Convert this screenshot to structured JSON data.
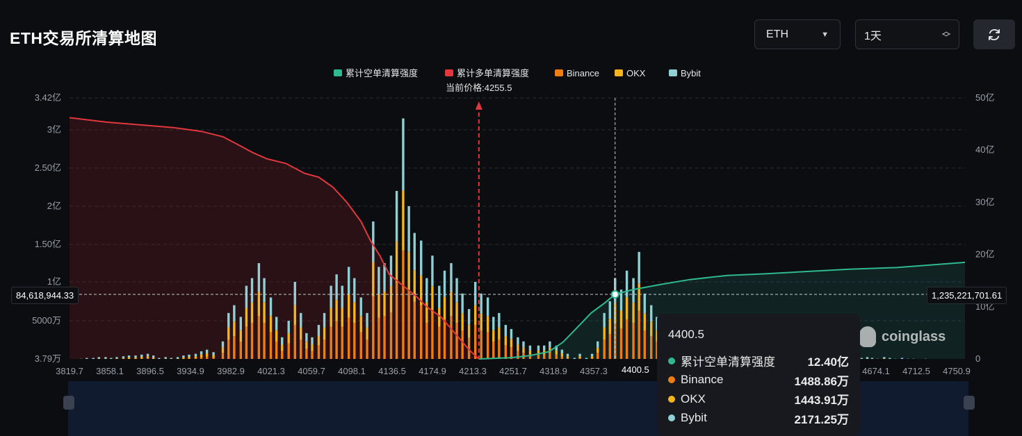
{
  "header": {
    "title": "ETH交易所清算地图",
    "coin_select": "ETH",
    "range_select": "1天",
    "refresh_icon": "refresh-icon"
  },
  "colors": {
    "short_line": "#2fb98f",
    "long_line": "#e2383d",
    "binance": "#f07d12",
    "okx": "#f4b51d",
    "bybit": "#8fd0d4",
    "marker": "#e2383d"
  },
  "chart_data": {
    "type": "bar",
    "x_ticks": [
      "3819.7",
      "3858.1",
      "3896.5",
      "3934.9",
      "3982.9",
      "4021.3",
      "4059.7",
      "4098.1",
      "4136.5",
      "4174.9",
      "4213.3",
      "4251.7",
      "4318.9",
      "4357.3",
      "4400.5",
      "",
      "",
      "",
      "",
      "",
      "4674.1",
      "4712.5",
      "4750.9"
    ],
    "left_axis": {
      "labels": [
        "3.79万",
        "5000万",
        "1亿",
        "1.50亿",
        "2亿",
        "2.50亿",
        "3亿",
        "3.42亿"
      ],
      "values": [
        0.0379,
        0.5,
        1.0,
        1.5,
        2.0,
        2.5,
        3.0,
        3.42
      ],
      "unit": "亿"
    },
    "right_axis": {
      "labels": [
        "0",
        "10亿",
        "20亿",
        "30亿",
        "40亿",
        "50亿"
      ],
      "values": [
        0,
        10,
        20,
        30,
        40,
        50
      ],
      "unit": "亿"
    },
    "legend": [
      {
        "name": "累计空单清算强度",
        "color": "#2fb98f"
      },
      {
        "name": "累计多单清算强度",
        "color": "#e2383d"
      },
      {
        "name": "Binance",
        "color": "#f07d12"
      },
      {
        "name": "OKX",
        "color": "#f4b51d"
      },
      {
        "name": "Bybit",
        "color": "#8fd0d4"
      }
    ],
    "current_price_label": "当前价格:4255.5",
    "current_price": 4255.5,
    "price_range": [
      3819.7,
      4773
    ],
    "bars": {
      "price": [
        3819.7,
        3826,
        3832,
        3838,
        3845,
        3851,
        3858.1,
        3864,
        3870,
        3877,
        3883,
        3890,
        3896.5,
        3903,
        3909,
        3915,
        3922,
        3928,
        3934.9,
        3941,
        3947,
        3954,
        3960,
        3966,
        3973,
        3982.9,
        3989,
        3995,
        4002,
        4008,
        4014,
        4021.3,
        4027,
        4034,
        4040,
        4046,
        4053,
        4059.7,
        4066,
        4072,
        4078,
        4085,
        4091,
        4098.1,
        4104,
        4110,
        4117,
        4123,
        4130,
        4136.5,
        4143,
        4149,
        4155,
        4162,
        4168,
        4174.9,
        4181,
        4187,
        4194,
        4200,
        4206,
        4213.3,
        4219,
        4226,
        4232,
        4238,
        4245,
        4251.7,
        4258,
        4265,
        4271,
        4277,
        4284,
        4290,
        4297,
        4303,
        4310,
        4318.9,
        4325,
        4331,
        4338,
        4344,
        4350,
        4357.3,
        4363,
        4370,
        4376,
        4382,
        4389,
        4395,
        4400.5,
        4407,
        4413,
        4420,
        4426,
        4432,
        4439,
        4445,
        4452,
        4458,
        4465,
        4471,
        4477,
        4484,
        4490,
        4497,
        4503,
        4509,
        4516,
        4522,
        4529,
        4535,
        4541,
        4548,
        4554,
        4561,
        4567,
        4573,
        4580,
        4586,
        4593,
        4599,
        4605,
        4612,
        4618,
        4625,
        4631,
        4637,
        4644,
        4650,
        4657,
        4663,
        4669,
        4674.1,
        4680,
        4687,
        4693,
        4699,
        4706,
        4712.5,
        4718,
        4725,
        4731,
        4737,
        4744,
        4750.9,
        4757,
        4763,
        4770
      ],
      "total": [
        0.03,
        0.03,
        0.04,
        0.05,
        0.05,
        0.06,
        0.06,
        0.05,
        0.06,
        0.07,
        0.08,
        0.08,
        0.09,
        0.1,
        0.08,
        0.05,
        0.06,
        0.05,
        0.06,
        0.08,
        0.09,
        0.1,
        0.13,
        0.15,
        0.12,
        0.25,
        0.6,
        0.7,
        0.55,
        0.95,
        1.05,
        1.25,
        1.05,
        0.8,
        0.55,
        0.3,
        0.5,
        1.0,
        0.6,
        0.35,
        0.3,
        0.45,
        0.6,
        0.95,
        1.1,
        0.95,
        1.2,
        1.05,
        0.8,
        0.6,
        1.8,
        1.2,
        1.25,
        1.35,
        2.2,
        3.15,
        2.0,
        1.65,
        1.55,
        1.05,
        1.35,
        0.95,
        1.15,
        1.25,
        1.05,
        0.85,
        0.65,
        1.0,
        0.85,
        0.8,
        0.55,
        0.6,
        0.45,
        0.4,
        0.3,
        0.25,
        0.2,
        0.2,
        0.2,
        0.25,
        0.2,
        0.15,
        0.1,
        0.05,
        0.1,
        0.05,
        0.1,
        0.25,
        0.6,
        0.75,
        1.05,
        0.9,
        1.15,
        1.05,
        1.4,
        0.85,
        0.7,
        0.55,
        0.45,
        0.4,
        0.45,
        0.4,
        0.5,
        0.45,
        0.35,
        0.3,
        0.35,
        0.25,
        0.25,
        0.2,
        0.15,
        0.15,
        0.1,
        0.12,
        0.12,
        0.08,
        0.1,
        0.08,
        0.07,
        0.06,
        0.07,
        0.05,
        0.06,
        0.05,
        0.05,
        0.04,
        0.04,
        0.05,
        0.04,
        0.05,
        0.04,
        0.05,
        0.06,
        0.05,
        0.04,
        0.06,
        0.05,
        0.04,
        0.05,
        0.04,
        0.04,
        0.03,
        0.04,
        0.03,
        0.02,
        0.02,
        0.02,
        0.02,
        0.02
      ],
      "binance_share": 0.45,
      "okx_share": 0.25,
      "bybit_share": 0.3
    },
    "long_cumulative": {
      "price": [
        3819.7,
        3860,
        3900,
        3930,
        3960,
        3982.9,
        4000,
        4015,
        4030,
        4050,
        4070,
        4085,
        4100,
        4115,
        4130,
        4140,
        4150,
        4160,
        4175,
        4190,
        4200,
        4215,
        4230,
        4245,
        4255.5
      ],
      "value": [
        3.16,
        3.1,
        3.06,
        3.03,
        2.98,
        2.91,
        2.8,
        2.7,
        2.62,
        2.56,
        2.43,
        2.38,
        2.25,
        2.05,
        1.8,
        1.55,
        1.35,
        1.1,
        0.95,
        0.8,
        0.68,
        0.55,
        0.35,
        0.15,
        0.0
      ]
    },
    "short_cumulative": {
      "price": [
        4255.5,
        4270,
        4290,
        4310,
        4330,
        4345,
        4360,
        4375,
        4390,
        4400.5,
        4420,
        4450,
        4480,
        4520,
        4560,
        4600,
        4650,
        4700,
        4773
      ],
      "value": [
        0.0,
        0.1,
        0.25,
        0.65,
        1.4,
        3.2,
        6.0,
        8.8,
        10.8,
        12.4,
        13.3,
        14.3,
        15.2,
        16.0,
        16.3,
        16.7,
        17.2,
        17.5,
        18.5
      ]
    },
    "hover": {
      "price": "4400.5",
      "left_value_label": "84,618,944.33",
      "right_value_label": "1,235,221,701.61",
      "rows": [
        {
          "name": "累计空单清算强度",
          "value": "12.40亿",
          "color": "#2fb98f"
        },
        {
          "name": "Binance",
          "value": "1488.86万",
          "color": "#f07d12"
        },
        {
          "name": "OKX",
          "value": "1443.91万",
          "color": "#f4b51d"
        },
        {
          "name": "Bybit",
          "value": "2171.25万",
          "color": "#8fd0d4"
        }
      ]
    }
  },
  "watermark": "coinglass"
}
